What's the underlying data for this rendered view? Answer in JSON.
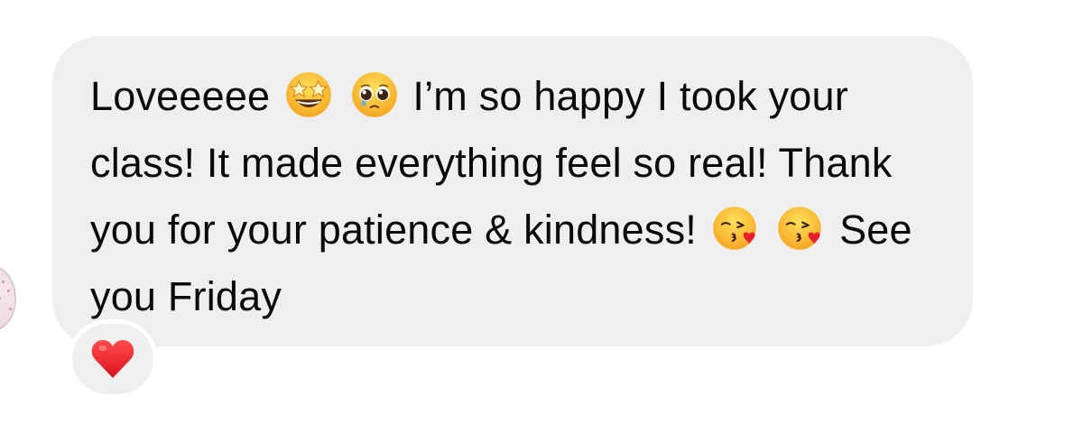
{
  "message": {
    "part1": "Loveeeee",
    "part2": "I’m so happy I took your class! It made everything feel so real! Thank you for your patience & kindness!",
    "part3": "See you Friday"
  },
  "emojis": {
    "star_struck": "star-struck-face-icon",
    "pleading": "pleading-face-icon",
    "kiss": "face-blowing-kiss-icon"
  },
  "reaction": {
    "icon": "red-heart-icon"
  },
  "colors": {
    "bubble_bg": "#efefef",
    "text": "#0a0a0a",
    "heart": "#e8202c"
  }
}
